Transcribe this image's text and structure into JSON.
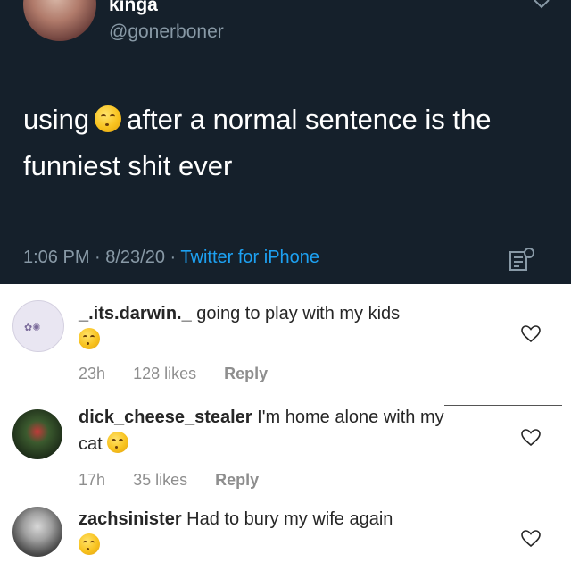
{
  "tweet": {
    "name": "kinga",
    "handle": "@gonerboner",
    "text_before_emoji": "using",
    "text_after_emoji": "after a normal sentence is the funniest shit ever",
    "emoji_icon": "smirking-face-emoji",
    "time": "1:06 PM · 8/23/20 · ",
    "source": "Twitter for iPhone"
  },
  "comments": [
    {
      "username": "_.its.darwin._",
      "text": "going to play with my kids",
      "age": "23h",
      "likes": "128 likes",
      "reply": "Reply"
    },
    {
      "username": "dick_cheese_stealer",
      "text": "I'm home alone with my cat",
      "age": "17h",
      "likes": "35 likes",
      "reply": "Reply"
    },
    {
      "username": "zachsinister",
      "text": "Had to bury my wife again"
    }
  ],
  "colors": {
    "tweet_bg": "#15202b",
    "link_blue": "#1da1f2",
    "muted": "#8899a6"
  }
}
